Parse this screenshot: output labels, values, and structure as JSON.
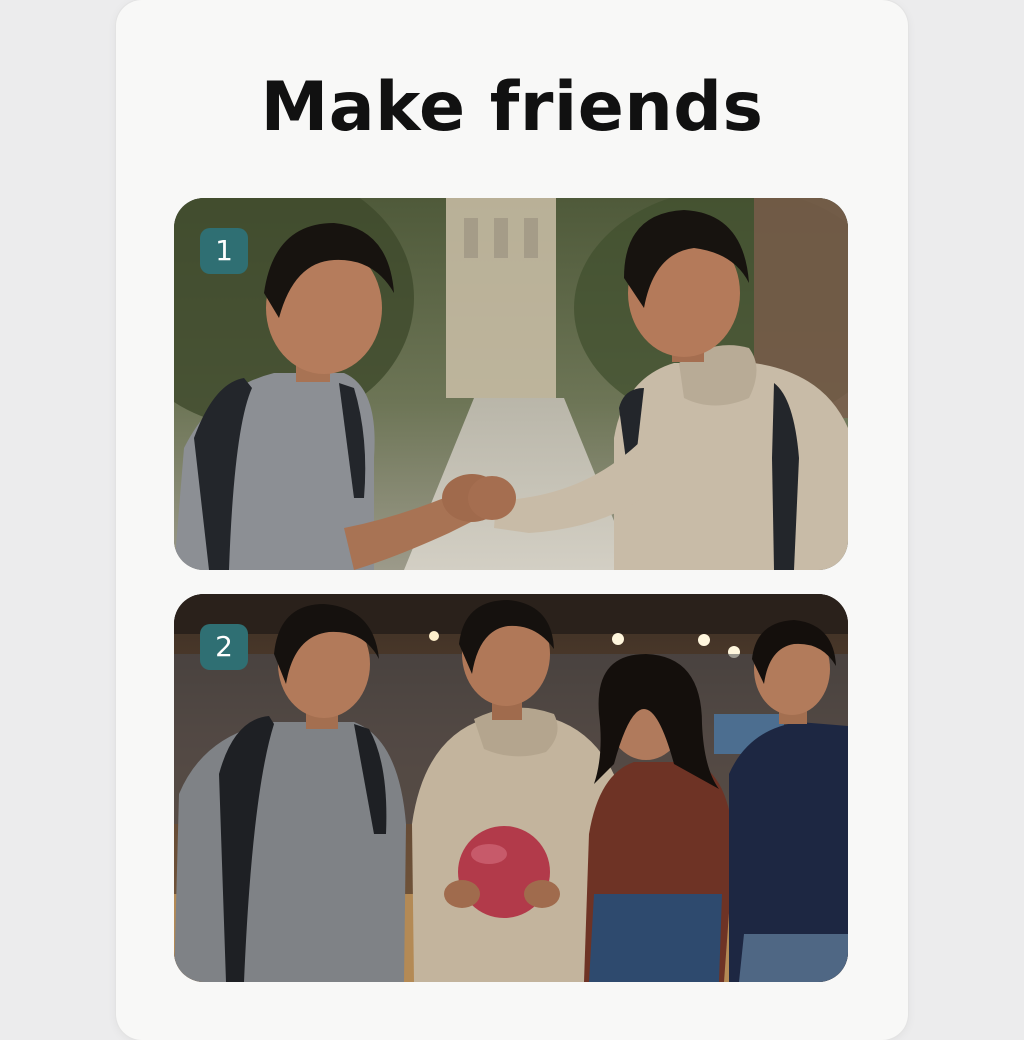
{
  "card": {
    "title": "Make friends"
  },
  "steps": [
    {
      "number": "1",
      "image_description": "Two young men fist-bumping outdoors on a campus path"
    },
    {
      "number": "2",
      "image_description": "Four young friends laughing together in a bowling alley, one holding a red bowling ball"
    }
  ],
  "colors": {
    "page_bg": "#ececed",
    "card_bg": "#f8f8f7",
    "badge_bg": "#2f6f73",
    "title_text": "#111111"
  }
}
